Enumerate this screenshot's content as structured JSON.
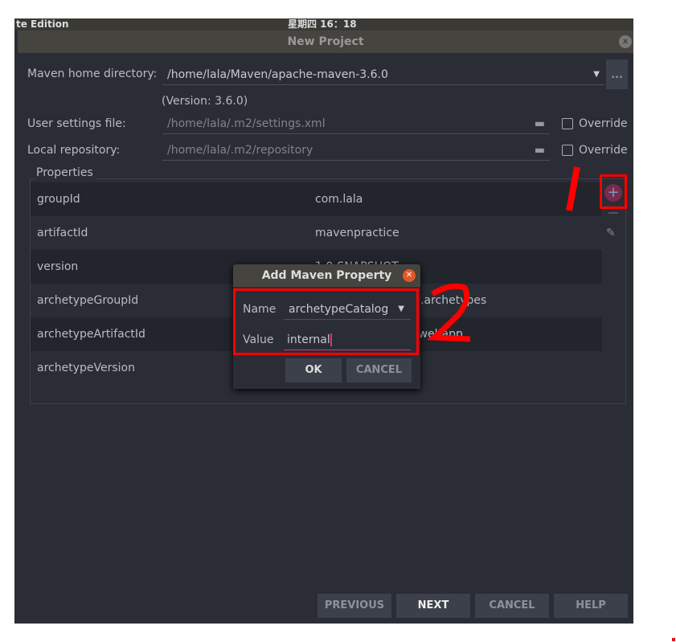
{
  "topbar": {
    "app": "te Edition",
    "clock": "星期四 16：18"
  },
  "window": {
    "title": "New Project"
  },
  "maven_home": {
    "label": "Maven home directory:",
    "value": "/home/lala/Maven/apache-maven-3.6.0",
    "browse": "...",
    "version": "(Version: 3.6.0)"
  },
  "user_settings": {
    "label": "User settings file:",
    "value": "/home/lala/.m2/settings.xml",
    "override": "Override"
  },
  "local_repo": {
    "label": "Local repository:",
    "value": "/home/lala/.m2/repository",
    "override": "Override"
  },
  "properties": {
    "label": "Properties",
    "rows": [
      {
        "key": "groupId",
        "value": "com.lala"
      },
      {
        "key": "artifactId",
        "value": "mavenpractice"
      },
      {
        "key": "version",
        "value": "1.0-SNAPSHOT"
      },
      {
        "key": "archetypeGroupId",
        "value": "org.apache.maven.archetypes"
      },
      {
        "key": "archetypeArtifactId",
        "value": "maven-archetype-webapp"
      },
      {
        "key": "archetypeVersion",
        "value": ""
      }
    ]
  },
  "dialog": {
    "title": "Add Maven Property",
    "name_label": "Name",
    "name_value": "archetypeCatalog",
    "value_label": "Value",
    "value_value": "internal",
    "ok": "OK",
    "cancel": "CANCEL"
  },
  "footer": {
    "previous": "PREVIOUS",
    "next": "NEXT",
    "cancel": "CANCEL",
    "help": "HELP"
  },
  "annotations": {
    "step1": "1",
    "step2": "2",
    "color": "#ff0000"
  },
  "colors": {
    "accent": "#e0336b",
    "background": "#2a2d36"
  }
}
